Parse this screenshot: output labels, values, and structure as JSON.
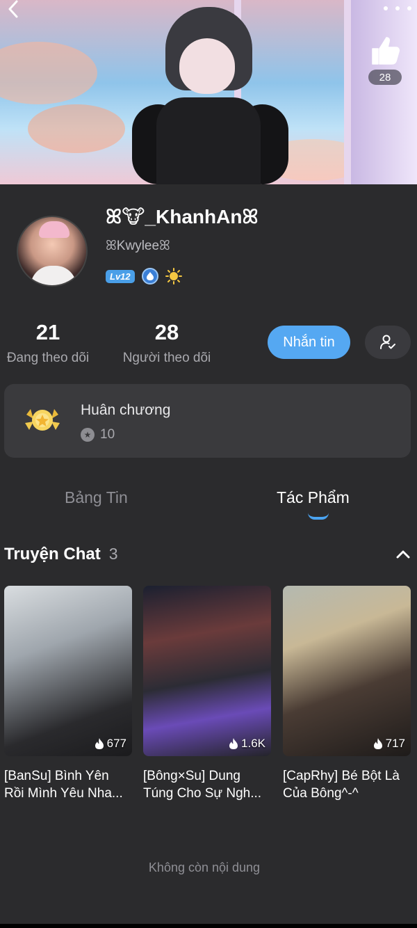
{
  "header": {
    "like_count": "28"
  },
  "profile": {
    "username": "ꕤ🐮_KhanhAnꕤ",
    "handle": "ꕤKwyleeꕤ",
    "level": "Lv12"
  },
  "stats": {
    "following_count": "21",
    "following_label": "Đang theo dõi",
    "followers_count": "28",
    "followers_label": "Người theo dõi"
  },
  "actions": {
    "message_label": "Nhắn tin"
  },
  "medal": {
    "title": "Huân chương",
    "count": "10"
  },
  "tabs": [
    {
      "label": "Bảng Tin",
      "active": false
    },
    {
      "label": "Tác Phẩm",
      "active": true
    }
  ],
  "section": {
    "title": "Truyện Chat",
    "count": "3"
  },
  "stories": [
    {
      "title": "[BanSu] Bình Yên Rồi Mình Yêu Nha...",
      "heat": "677"
    },
    {
      "title": "[Bông×Su] Dung Túng Cho Sự Ngh...",
      "heat": "1.6K"
    },
    {
      "title": "[CapRhy] Bé Bột Là Của Bông^-^",
      "heat": "717"
    }
  ],
  "footer": {
    "end_text": "Không còn nội dung"
  },
  "colors": {
    "accent": "#55a8f2",
    "background": "#2b2b2d",
    "card": "#3a3a3d"
  }
}
